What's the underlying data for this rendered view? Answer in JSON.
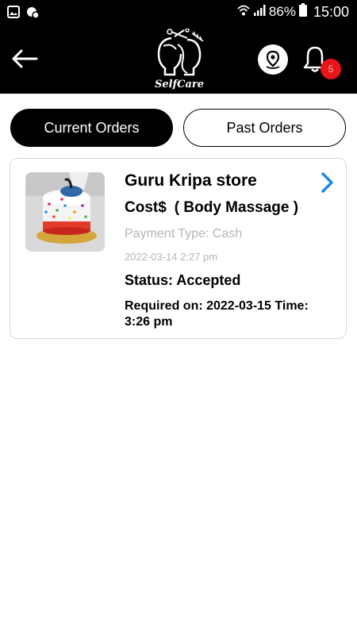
{
  "status_bar": {
    "battery": "86%",
    "time": "15:00"
  },
  "header": {
    "logo_text": "SelfCare",
    "notification_count": "5"
  },
  "tabs": [
    {
      "label": "Current Orders",
      "active": true
    },
    {
      "label": "Past Orders",
      "active": false
    }
  ],
  "order": {
    "store_name": "Guru Kripa store",
    "cost_label": "Cost$",
    "service": "( Body Massage )",
    "payment_type": "Payment Type: Cash",
    "date": "2022-03-14 2:27 pm",
    "status": "Status: Accepted",
    "required": "Required on: 2022-03-15  Time: 3:26 pm"
  },
  "colors": {
    "header_bg": "#000000",
    "active_tab_bg": "#000000",
    "badge": "#e8161a",
    "chevron": "#1e88e5",
    "muted_text": "#b5b5b5"
  },
  "icons": {
    "back": "arrow-left-icon",
    "location": "location-pin-icon",
    "notifications": "bell-icon",
    "open_order": "chevron-right-icon"
  }
}
